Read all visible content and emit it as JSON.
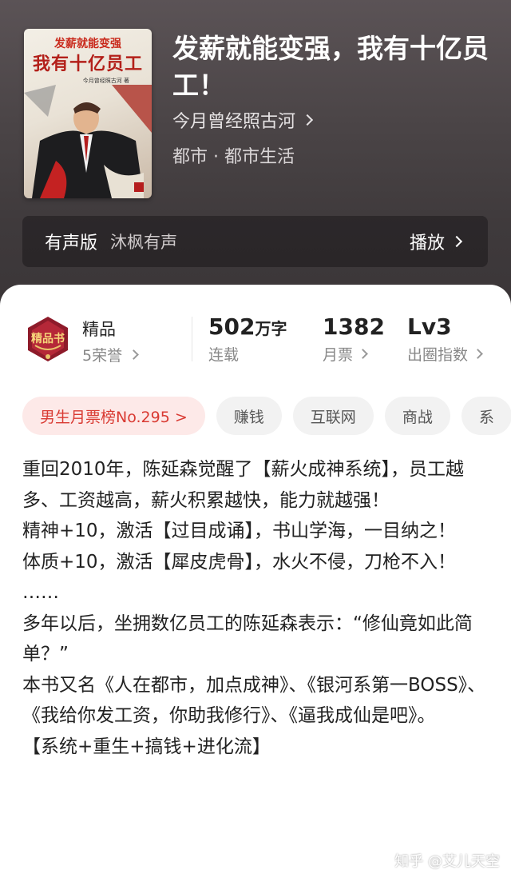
{
  "book": {
    "cover_title_top": "发薪就能变强",
    "cover_title_main": "我有十亿员工",
    "cover_author": "今月曾经照古河 著",
    "title": "发薪就能变强，我有十亿员工！",
    "author": "今月曾经照古河",
    "genre": "都市 · 都市生活"
  },
  "audio": {
    "label": "有声版",
    "narrator": "沐枫有声",
    "play_label": "播放"
  },
  "stats": {
    "premium_label": "精品",
    "honor_label": "5荣誉",
    "badge_text": "精品书",
    "words_value": "502",
    "words_unit": "万字",
    "words_caption": "连载",
    "tickets_value": "1382",
    "tickets_caption": "月票",
    "level_value": "Lv3",
    "level_caption": "出圈指数"
  },
  "tags": {
    "rank": "男生月票榜No.295 >",
    "items": [
      "赚钱",
      "互联网",
      "商战",
      "系"
    ]
  },
  "description": [
    "重回2010年，陈延森觉醒了【薪火成神系统】，员工越多、工资越高，薪火积累越快，能力就越强！",
    "精神+10，激活【过目成诵】，书山学海，一目纳之！",
    "体质+10，激活【犀皮虎骨】，水火不侵，刀枪不入！",
    "……",
    "多年以后，坐拥数亿员工的陈延森表示：“修仙竟如此简单？”",
    "本书又名《人在都市，加点成神》、《银河系第一BOSS》、《我给你发工资，你助我修行》、《逼我成仙是吧》。",
    "【系统+重生+搞钱+进化流】"
  ],
  "watermark": "知乎 @艾儿天空",
  "colors": {
    "rank_text": "#d93a32",
    "rank_bg": "#fde9e8",
    "hero_bg": "#4a4446"
  }
}
